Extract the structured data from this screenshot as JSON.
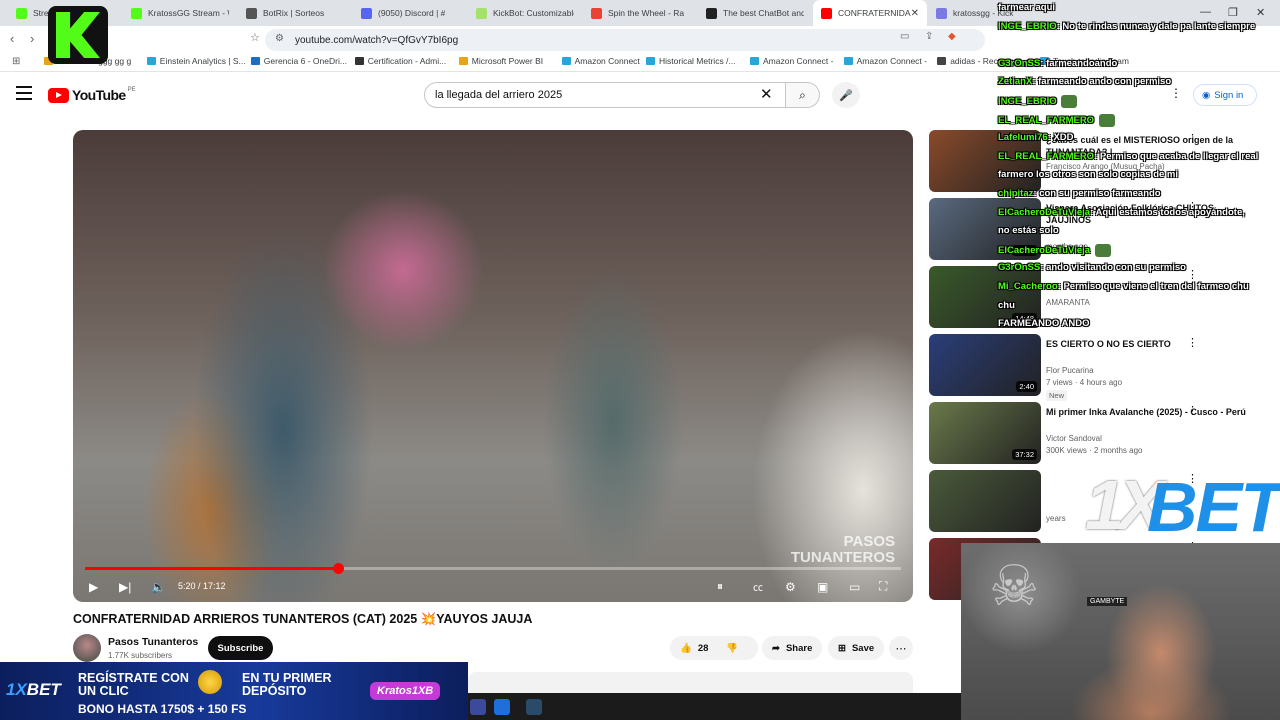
{
  "browser": {
    "tabs": [
      {
        "label": "Stream - Kick",
        "color": "#53fc18"
      },
      {
        "label": "KratossGG Stream - W",
        "color": "#53fc18"
      },
      {
        "label": "BotRix | Sorteos",
        "color": "#555555"
      },
      {
        "label": "(9050) Discord | #",
        "color": "#5865f2"
      },
      {
        "label": "KickBot: Customizable",
        "color": "#a4e26b"
      },
      {
        "label": "Spin the Wheel - Ra",
        "color": "#ea4335"
      },
      {
        "label": "The best ChatBot and",
        "color": "#222222"
      },
      {
        "label": "CONFRATERNIDA",
        "color": "#ff0000",
        "active": true
      },
      {
        "label": "kratossgg - Kick",
        "color": "#7a7ae0"
      }
    ],
    "url": "youtube.com/watch?v=QfGvY7bI6pg",
    "bookmarks": [
      "cccccccc 0ggg gg g",
      "Einstein Analytics | S...",
      "Gerencia 6 - OneDri...",
      "Certification - Admi...",
      "Microsoft Power BI",
      "Amazon Connect",
      "Historical Metrics /...",
      "Amazon Connect -",
      "Amazon Connect -",
      "adidas - Recontact",
      "Touch to India Team"
    ]
  },
  "youtube": {
    "logo_text": "YouTube",
    "country_code": "PE",
    "search_query": "la llegada del arriero 2025",
    "sign_in": "Sign in",
    "player": {
      "time": "5:20 / 17:12",
      "progress_fraction": 0.31,
      "watermark_line1": "PASOS",
      "watermark_line2": "TUNANTEROS"
    },
    "video_title": "CONFRATERNIDAD ARRIEROS TUNANTEROS (CAT) 2025 💥YAUYOS JAUJA",
    "channel_name": "Pasos Tunanteros",
    "subscribers": "1.77K subscribers",
    "subscribe_label": "Subscribe",
    "likes": "28",
    "share_label": "Share",
    "save_label": "Save",
    "recommendations": [
      {
        "title": "¿Sabes cuál es el MISTERIOSO origen de la TUNANTADA? |...",
        "channel": "Francisco Arango (Musuq Pacha)",
        "meta": "",
        "duration": "",
        "thumb": "#8a4a2a"
      },
      {
        "title": "Visnera Asociación Folklórica CHUTOS JAUJINOS",
        "channel": "",
        "meta": "months ago",
        "duration": "13:07",
        "thumb": "#5a6a80"
      },
      {
        "title": "",
        "channel": "AMARANTA",
        "meta": "",
        "duration": "14:48",
        "thumb": "#3a5a2a"
      },
      {
        "title": "ES CIERTO O NO ES CIERTO",
        "channel": "Flor Pucarina",
        "meta": "7 views · 4 hours ago",
        "badge": "New",
        "duration": "2:40",
        "thumb": "#2a3e7a"
      },
      {
        "title": "Mi primer Inka Avalanche (2025) - Cusco - Perú",
        "channel": "Victor Sandoval",
        "meta": "300K views · 2 months ago",
        "duration": "37:32",
        "thumb": "#6a7a4a"
      },
      {
        "title": "",
        "channel": "",
        "meta": "years",
        "duration": "",
        "thumb": "#4a5a3a"
      },
      {
        "title": "",
        "channel": "",
        "meta": "",
        "duration": "",
        "thumb": "#7a2a2a"
      }
    ]
  },
  "overlay": {
    "chat": [
      {
        "user": "",
        "text": "farmear aqui"
      },
      {
        "user": "INGE_EBRIO",
        "text": "No te rindas nunca y dale pa lante siempre"
      },
      {
        "user": "",
        "text": ""
      },
      {
        "user": "G3rOnSS",
        "text": "farmeandoando"
      },
      {
        "user": "ZetianX",
        "text": "farmeando ando con permiso"
      },
      {
        "user": "INGE_EBRIO",
        "text": ""
      },
      {
        "user": "EL_REAL_FARMERO",
        "text": ""
      },
      {
        "user": "Lafelumi76",
        "text": "XDD"
      },
      {
        "user": "EL_REAL_FARMERO",
        "text": "Permiso que acaba de llegar el real"
      },
      {
        "user": "",
        "text": "farmero los otros son solo copias de mi"
      },
      {
        "user": "chipitaz",
        "text": "con su permiso farmeando"
      },
      {
        "user": "ElCacheroDeTuVieja",
        "text": "Aqui estamos todos apoyándote,"
      },
      {
        "user": "",
        "text": "no estás solo"
      },
      {
        "user": "ElCacheroDeTuVieja",
        "text": ""
      },
      {
        "user": "G3rOnSS",
        "text": "ando visitando con su permiso"
      },
      {
        "user": "Mi_Cacheroo",
        "text": "Permiso que viene el tren del farmeo chu"
      },
      {
        "user": "",
        "text": "chu"
      },
      {
        "user": "",
        "text": "FARMEANDO ANDO"
      }
    ],
    "bet_brand": "1X",
    "bet_word": "BET",
    "headset_brand": "GAMBYTE",
    "promo": {
      "brand": "1XBET",
      "line1a": "REGÍSTRATE CON",
      "line1b": "UN CLIC",
      "line2a": "EN TU PRIMER",
      "line2b": "DEPÓSITO",
      "line3": "BONO HASTA 1750$ + 150 FS",
      "code": "Kratos1XB"
    }
  },
  "colors": {
    "yt_red": "#ff0000",
    "kick_green": "#53fc18",
    "bet_blue": "#1e90e8"
  }
}
